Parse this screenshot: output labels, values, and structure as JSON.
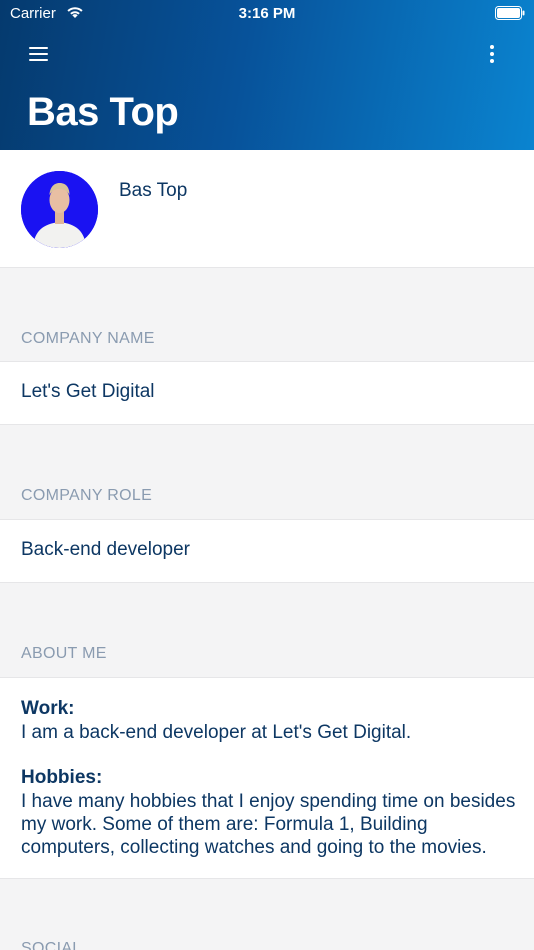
{
  "status_bar": {
    "carrier": "Carrier",
    "time": "3:16 PM"
  },
  "header": {
    "title": "Bas Top"
  },
  "profile": {
    "name": "Bas Top"
  },
  "sections": {
    "company_name": {
      "label": "COMPANY NAME",
      "value": "Let's Get Digital"
    },
    "company_role": {
      "label": "COMPANY ROLE",
      "value": "Back-end developer"
    },
    "about_me": {
      "label": "ABOUT ME",
      "work_heading": "Work:",
      "work_text": "I am a back-end developer at Let's Get Digital.",
      "hobbies_heading": "Hobbies:",
      "hobbies_text": "I have many hobbies that I enjoy spending time on besides my work. Some of them are: Formula 1, Building computers, collecting watches and going to the movies."
    },
    "social": {
      "label": "SOCIAL"
    }
  },
  "colors": {
    "header_start": "#053a6e",
    "header_end": "#0a84d0",
    "text": "#0d3763",
    "label": "#8a9bb0",
    "avatar_bg": "#1a12f2"
  },
  "icons": [
    "wifi-icon",
    "battery-icon",
    "menu-icon",
    "more-vertical-icon"
  ]
}
